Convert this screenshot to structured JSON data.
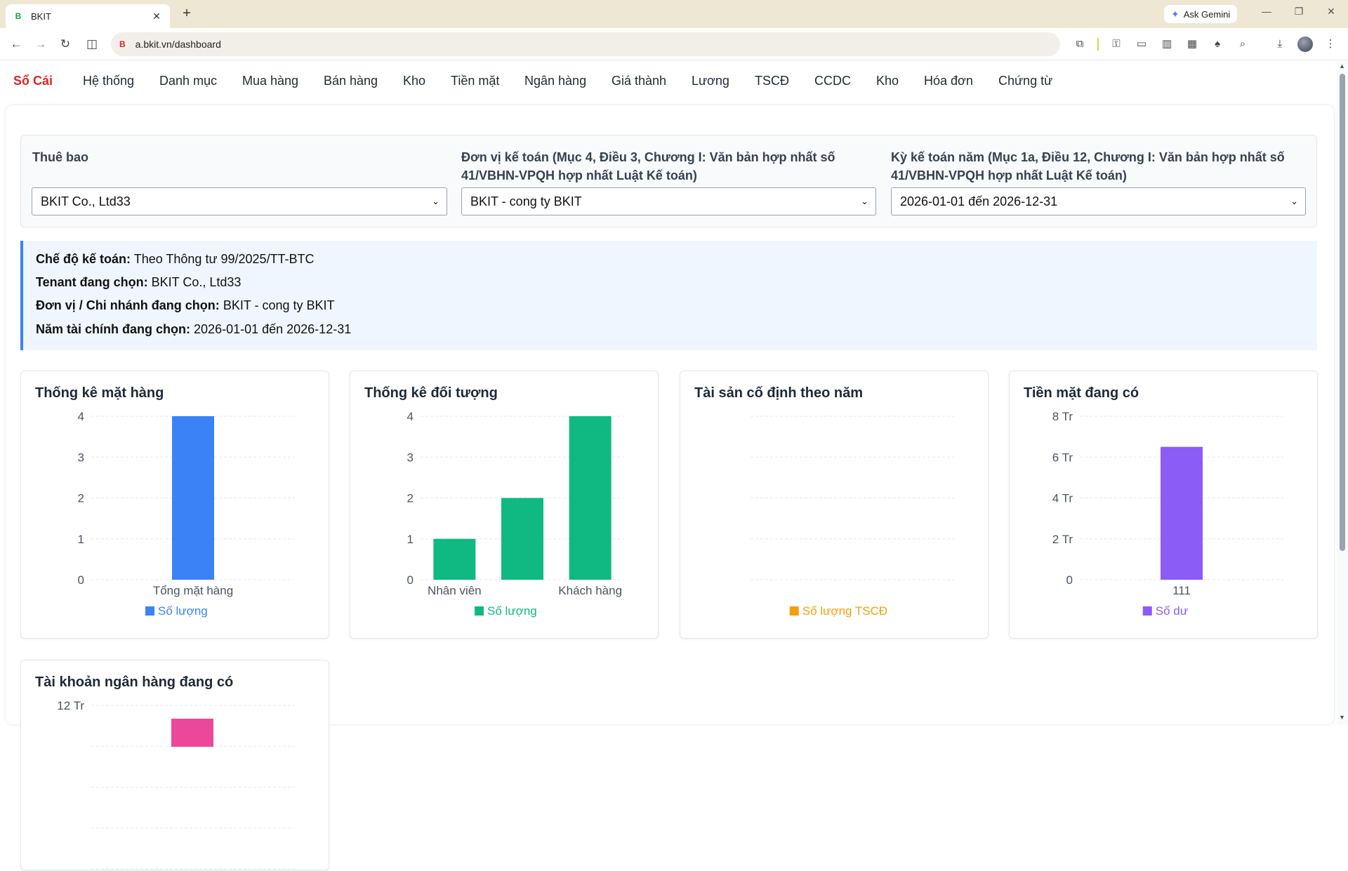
{
  "browser": {
    "tab_title": "BKIT",
    "tab_favicon": "B",
    "url": "a.bkit.vn/dashboard",
    "ask_gemini": "Ask Gemini"
  },
  "nav": {
    "brand": "Sổ Cái",
    "items": [
      "Hệ thống",
      "Danh mục",
      "Mua hàng",
      "Bán hàng",
      "Kho",
      "Tiền mặt",
      "Ngân hàng",
      "Giá thành",
      "Lương",
      "TSCĐ",
      "CCDC",
      "Kho",
      "Hóa đơn",
      "Chứng từ"
    ]
  },
  "filters": {
    "subscription": {
      "label": "Thuê bao",
      "value": "BKIT Co., Ltd33"
    },
    "unit": {
      "label_line1": "Đơn vị kế toán (Mục 4, Điều 3, Chương I: Văn bản hợp nhất số",
      "label_line2": "41/VBHN-VPQH hợp nhất Luật Kế toán)",
      "value": "BKIT - cong ty BKIT"
    },
    "period": {
      "label_line1": "Kỳ kế toán năm (Mục 1a, Điều 12, Chương I: Văn bản hợp nhất số",
      "label_line2": "41/VBHN-VPQH hợp nhất Luật Kế toán)",
      "value": "2026-01-01 đến 2026-12-31"
    }
  },
  "info": {
    "regime_label": "Chế độ kế toán:",
    "regime_value": "Theo Thông tư 99/2025/TT-BTC",
    "tenant_label": "Tenant đang chọn:",
    "tenant_value": "BKIT Co., Ltd33",
    "unit_label": "Đơn vị / Chi nhánh đang chọn:",
    "unit_value": "BKIT - cong ty BKIT",
    "year_label": "Năm tài chính đang chọn:",
    "year_value": "2026-01-01 đến 2026-12-31"
  },
  "chart_data": [
    {
      "type": "bar",
      "title": "Thống kê mặt hàng",
      "categories": [
        "Tổng mặt hàng"
      ],
      "series": [
        {
          "name": "Số lượng",
          "values": [
            4
          ]
        }
      ],
      "ylim": [
        0,
        4
      ],
      "yticks": [
        "0",
        "1",
        "2",
        "3",
        "4"
      ],
      "color": "#3b82f6",
      "grid": true,
      "legend": "bottom"
    },
    {
      "type": "bar",
      "title": "Thống kê đối tượng",
      "categories": [
        "Nhân viên",
        "",
        "Khách hàng"
      ],
      "series": [
        {
          "name": "Số lượng",
          "values": [
            1,
            2,
            4
          ]
        }
      ],
      "ylim": [
        0,
        4
      ],
      "yticks": [
        "0",
        "1",
        "2",
        "3",
        "4"
      ],
      "color": "#10b981",
      "grid": true,
      "legend": "bottom"
    },
    {
      "type": "bar",
      "title": "Tài sản cố định theo năm",
      "categories": [],
      "series": [
        {
          "name": "Số lượng TSCĐ",
          "values": []
        }
      ],
      "yticks": [],
      "color": "#f59e0b",
      "grid": true,
      "legend": "bottom"
    },
    {
      "type": "bar",
      "title": "Tiền mặt đang có",
      "categories": [
        "111"
      ],
      "series": [
        {
          "name": "Số dư",
          "values": [
            6500000
          ]
        }
      ],
      "ylim": [
        0,
        8000000
      ],
      "yticks": [
        "0",
        "2 Tr",
        "4 Tr",
        "6 Tr",
        "8 Tr"
      ],
      "color": "#8b5cf6",
      "grid": true,
      "legend": "bottom"
    },
    {
      "type": "bar",
      "title": "Tài khoản ngân hàng đang có",
      "categories": [],
      "series": [
        {
          "values": []
        }
      ],
      "yticks": [
        "12 Tr"
      ],
      "color": "#ec4899",
      "grid": true,
      "legend": "bottom"
    }
  ]
}
